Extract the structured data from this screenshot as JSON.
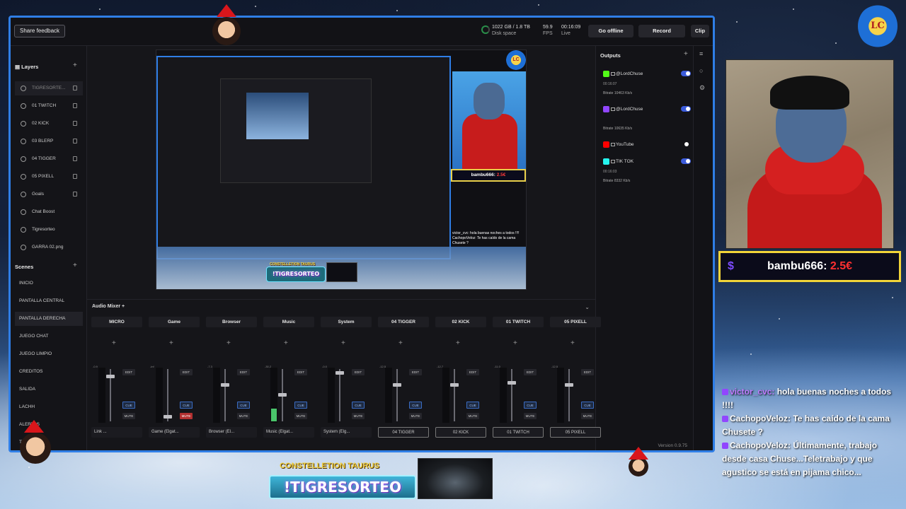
{
  "topbar": {
    "share_feedback": "Share feedback",
    "disk_value": "1022 GB / 1.8 TB",
    "disk_label": "Disk space",
    "fps_value": "59.9",
    "fps_label": "FPS",
    "live_value": "00:16:09",
    "live_label": "Live",
    "go_offline": "Go offline",
    "record": "Record",
    "clip": "Clip"
  },
  "layers": {
    "title": "Layers",
    "items": [
      {
        "label": "TIGRESORTE..."
      },
      {
        "label": "01 TWITCH"
      },
      {
        "label": "02 KICK"
      },
      {
        "label": "03 BLERP"
      },
      {
        "label": "04 TIGGER"
      },
      {
        "label": "05 PIXELL"
      },
      {
        "label": "Goals"
      },
      {
        "label": "Chat Boost"
      },
      {
        "label": "Tigresorteo"
      },
      {
        "label": "GARRA 02.png"
      }
    ]
  },
  "scenes": {
    "title": "Scenes",
    "items": [
      {
        "label": "INICIO"
      },
      {
        "label": "PANTALLA CENTRAL"
      },
      {
        "label": "PANTALLA DERECHA"
      },
      {
        "label": "JUEGO CHAT"
      },
      {
        "label": "JUEGO LIMPIO"
      },
      {
        "label": "CREDITOS"
      },
      {
        "label": "SALIDA"
      },
      {
        "label": "LACHH"
      },
      {
        "label": "ALERTAS"
      },
      {
        "label": "TIGR"
      }
    ]
  },
  "outputs": {
    "title": "Outputs",
    "items": [
      {
        "name": "@LordChuse",
        "time": "00:16:07",
        "bitrate": "Bitrate  10463 Kb/s",
        "color": "#53fc18",
        "enabled": true
      },
      {
        "name": "@LordChuse",
        "time": "",
        "bitrate": "Bitrate  10635 Kb/s",
        "color": "#9146ff",
        "enabled": true
      },
      {
        "name": "YouTube",
        "time": "",
        "bitrate": "",
        "color": "#ff0000",
        "enabled": false
      },
      {
        "name": "TIK TOK",
        "time": "00:16:03",
        "bitrate": "Bitrate  8332 Kb/s",
        "color": "#25f4ee",
        "enabled": true
      }
    ]
  },
  "mixer": {
    "title": "Audio Mixer",
    "edit": "EDIT",
    "cue": "CUE",
    "mute": "MUTE",
    "channels": [
      {
        "name": "MICRO",
        "source": "Link ...",
        "db": "-0.9",
        "boxed": false,
        "muted": false
      },
      {
        "name": "Game",
        "source": "Game (Elgat...",
        "db": "-inf",
        "boxed": false,
        "muted": true
      },
      {
        "name": "Browser",
        "source": "Browser (El...",
        "db": "-7.3",
        "boxed": false,
        "muted": false
      },
      {
        "name": "Music",
        "source": "Music (Elgat...",
        "db": "-30.2",
        "boxed": false,
        "muted": false
      },
      {
        "name": "System",
        "source": "System (Elg...",
        "db": "-0.0",
        "boxed": false,
        "muted": false
      },
      {
        "name": "04 TIGGER",
        "source": "04 TIGGER",
        "db": "-12.5",
        "boxed": true,
        "muted": false
      },
      {
        "name": "02 KICK",
        "source": "02 KICK",
        "db": "-12.7",
        "boxed": true,
        "muted": false
      },
      {
        "name": "01 TWITCH",
        "source": "01 TWITCH",
        "db": "-11.0",
        "boxed": true,
        "muted": false
      },
      {
        "name": "05 PIXELL",
        "source": "05 PIXELL",
        "db": "-12.5",
        "boxed": true,
        "muted": false
      }
    ]
  },
  "version": "Version 0.9.75",
  "overlay": {
    "donation_user": "bambu666:",
    "donation_amount": "2.5€",
    "banner_caption": "CONSTELLETION TAURUS",
    "banner_text": "!TIGRESORTEO",
    "logo_text": "LC",
    "chat": [
      {
        "user": "victor_cvc:",
        "message": "hola buenas noches a todos !!!!"
      },
      {
        "user": "CachopoVeloz:",
        "message": "Te has caído de la cama Chusete ?"
      },
      {
        "user": "CachopoVeloz:",
        "message": "Últimamente, trabajo desde casa Chuse...Teletrabajo y que agustico se está en pijama chico..."
      }
    ]
  }
}
